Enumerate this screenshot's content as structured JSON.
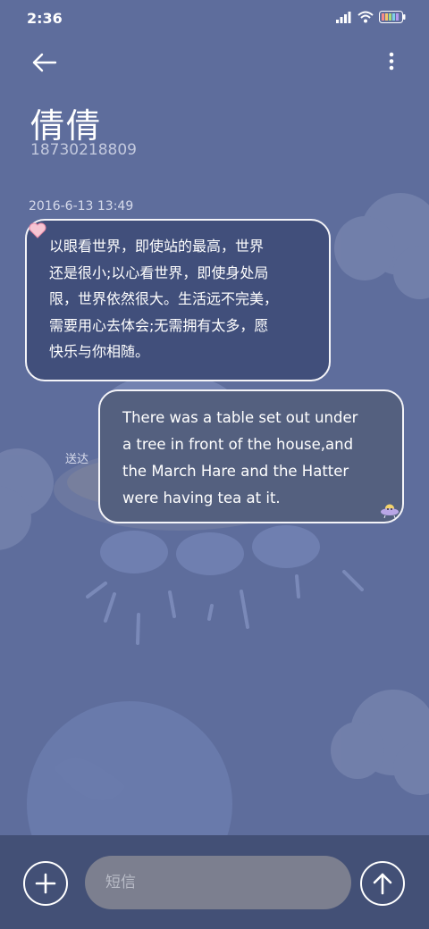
{
  "status_bar": {
    "time": "2:36",
    "icons": [
      "signal-icon",
      "wifi-icon",
      "battery-icon"
    ]
  },
  "header": {
    "back_icon": "arrow-left-icon",
    "menu_icon": "more-vertical-icon",
    "contact_name": "倩倩",
    "contact_phone": "18730218809"
  },
  "conversation": {
    "timestamp": "2016-6-13 13:49",
    "messages": [
      {
        "direction": "incoming",
        "sticker": "heart-icon",
        "text": "以眼看世界，即使站的最高，世界\n还是很小;以心看世界，即使身处局\n限，世界依然很大。生活远不完美，\n需要用心去体会;无需拥有太多，愿\n快乐与你相随。"
      },
      {
        "direction": "outgoing",
        "sticker": "ufo-icon",
        "status": "送达",
        "text": "There was a table set out under\na tree in front of the house,and\nthe March Hare and the Hatter\nwere having tea at it."
      }
    ]
  },
  "composer": {
    "add_icon": "plus-icon",
    "placeholder": "短信",
    "value": "",
    "send_icon": "arrow-up-icon"
  },
  "colors": {
    "background": "#5e6d9c",
    "incoming_bubble": "#414f7b",
    "outgoing_bubble": "#54607f",
    "bottom_bar": "#435076",
    "input_field": "#7c7f8f"
  }
}
